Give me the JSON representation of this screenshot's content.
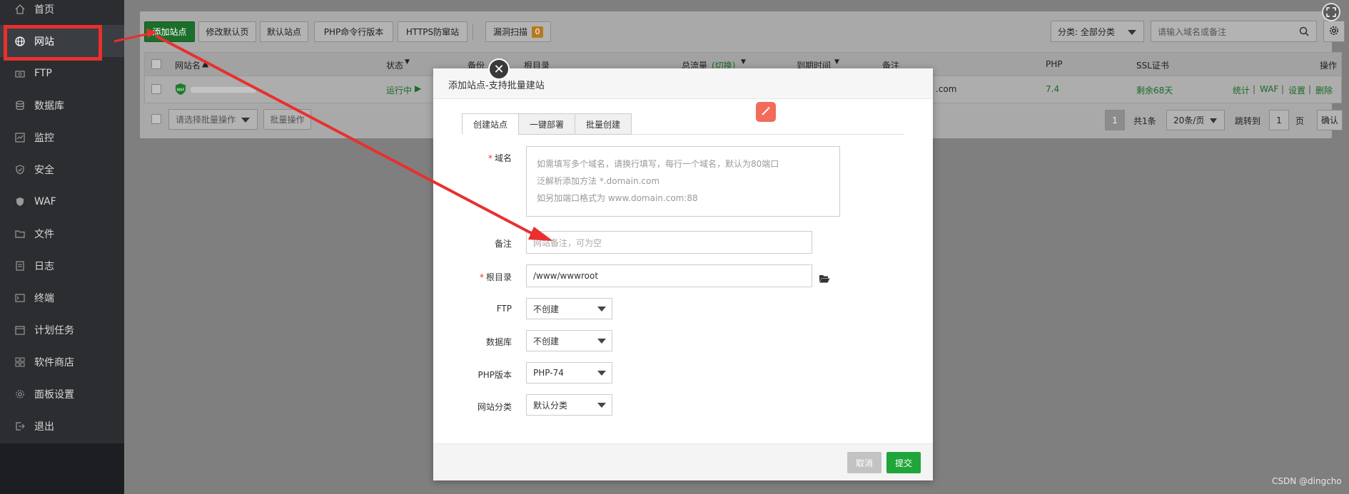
{
  "sidebar": {
    "items": [
      {
        "label": "首页",
        "icon": "home-icon"
      },
      {
        "label": "网站",
        "icon": "globe-icon",
        "active": true
      },
      {
        "label": "FTP",
        "icon": "ftp-icon"
      },
      {
        "label": "数据库",
        "icon": "database-icon"
      },
      {
        "label": "监控",
        "icon": "monitor-icon"
      },
      {
        "label": "安全",
        "icon": "shield-icon"
      },
      {
        "label": "WAF",
        "icon": "waf-shield-icon"
      },
      {
        "label": "文件",
        "icon": "folder-icon"
      },
      {
        "label": "日志",
        "icon": "log-icon"
      },
      {
        "label": "终端",
        "icon": "terminal-icon"
      },
      {
        "label": "计划任务",
        "icon": "calendar-icon"
      },
      {
        "label": "软件商店",
        "icon": "apps-icon"
      },
      {
        "label": "面板设置",
        "icon": "gear-icon"
      },
      {
        "label": "退出",
        "icon": "logout-icon"
      }
    ]
  },
  "toolbar": {
    "add_site": "添加站点",
    "modify_default_page": "修改默认页",
    "default_site": "默认站点",
    "php_cli_version": "PHP命令行版本",
    "https_protection": "HTTPS防窜站",
    "vuln_scan": "漏洞扫描",
    "vuln_count": "0",
    "category_select": "分类: 全部分类",
    "search_placeholder": "请输入域名或备注"
  },
  "table": {
    "headers": {
      "site_name": "网站名",
      "status": "状态",
      "backup": "备份",
      "root_dir": "根目录",
      "traffic": "总流量",
      "traffic_switch": "(切换)",
      "expire": "到期时间",
      "remark": "备注",
      "php": "PHP",
      "ssl": "SSL证书",
      "ops": "操作"
    },
    "row": {
      "status": "运行中",
      "remark_tail": ".com",
      "php": "7.4",
      "ssl": "剩余68天",
      "ops": [
        "统计",
        "WAF",
        "设置",
        "删除"
      ]
    },
    "batch_placeholder": "请选择批量操作",
    "batch_button": "批量操作",
    "pagination": {
      "current_page": "1",
      "total": "共1条",
      "per_page": "20条/页",
      "jump_label": "跳转到",
      "jump_value": "1",
      "page_unit": "页",
      "confirm": "确认"
    }
  },
  "modal": {
    "title": "添加站点-支持批量建站",
    "tabs": [
      "创建站点",
      "一键部署",
      "批量创建"
    ],
    "domain_label": "域名",
    "domain_hints": [
      "如需填写多个域名，请换行填写，每行一个域名，默认为80端口",
      "泛解析添加方法 *.domain.com",
      "如另加端口格式为 www.domain.com:88"
    ],
    "remark_label": "备注",
    "remark_placeholder": "网站备注，可为空",
    "root_label": "根目录",
    "root_value": "/www/wwwroot",
    "ftp_label": "FTP",
    "ftp_value": "不创建",
    "db_label": "数据库",
    "db_value": "不创建",
    "php_label": "PHP版本",
    "php_value": "PHP-74",
    "category_label": "网站分类",
    "category_value": "默认分类",
    "cancel": "取消",
    "submit": "提交"
  },
  "watermark": "CSDN @dingcho",
  "colors": {
    "accent_green": "#20a53a",
    "annotation_red": "#e8302f"
  }
}
